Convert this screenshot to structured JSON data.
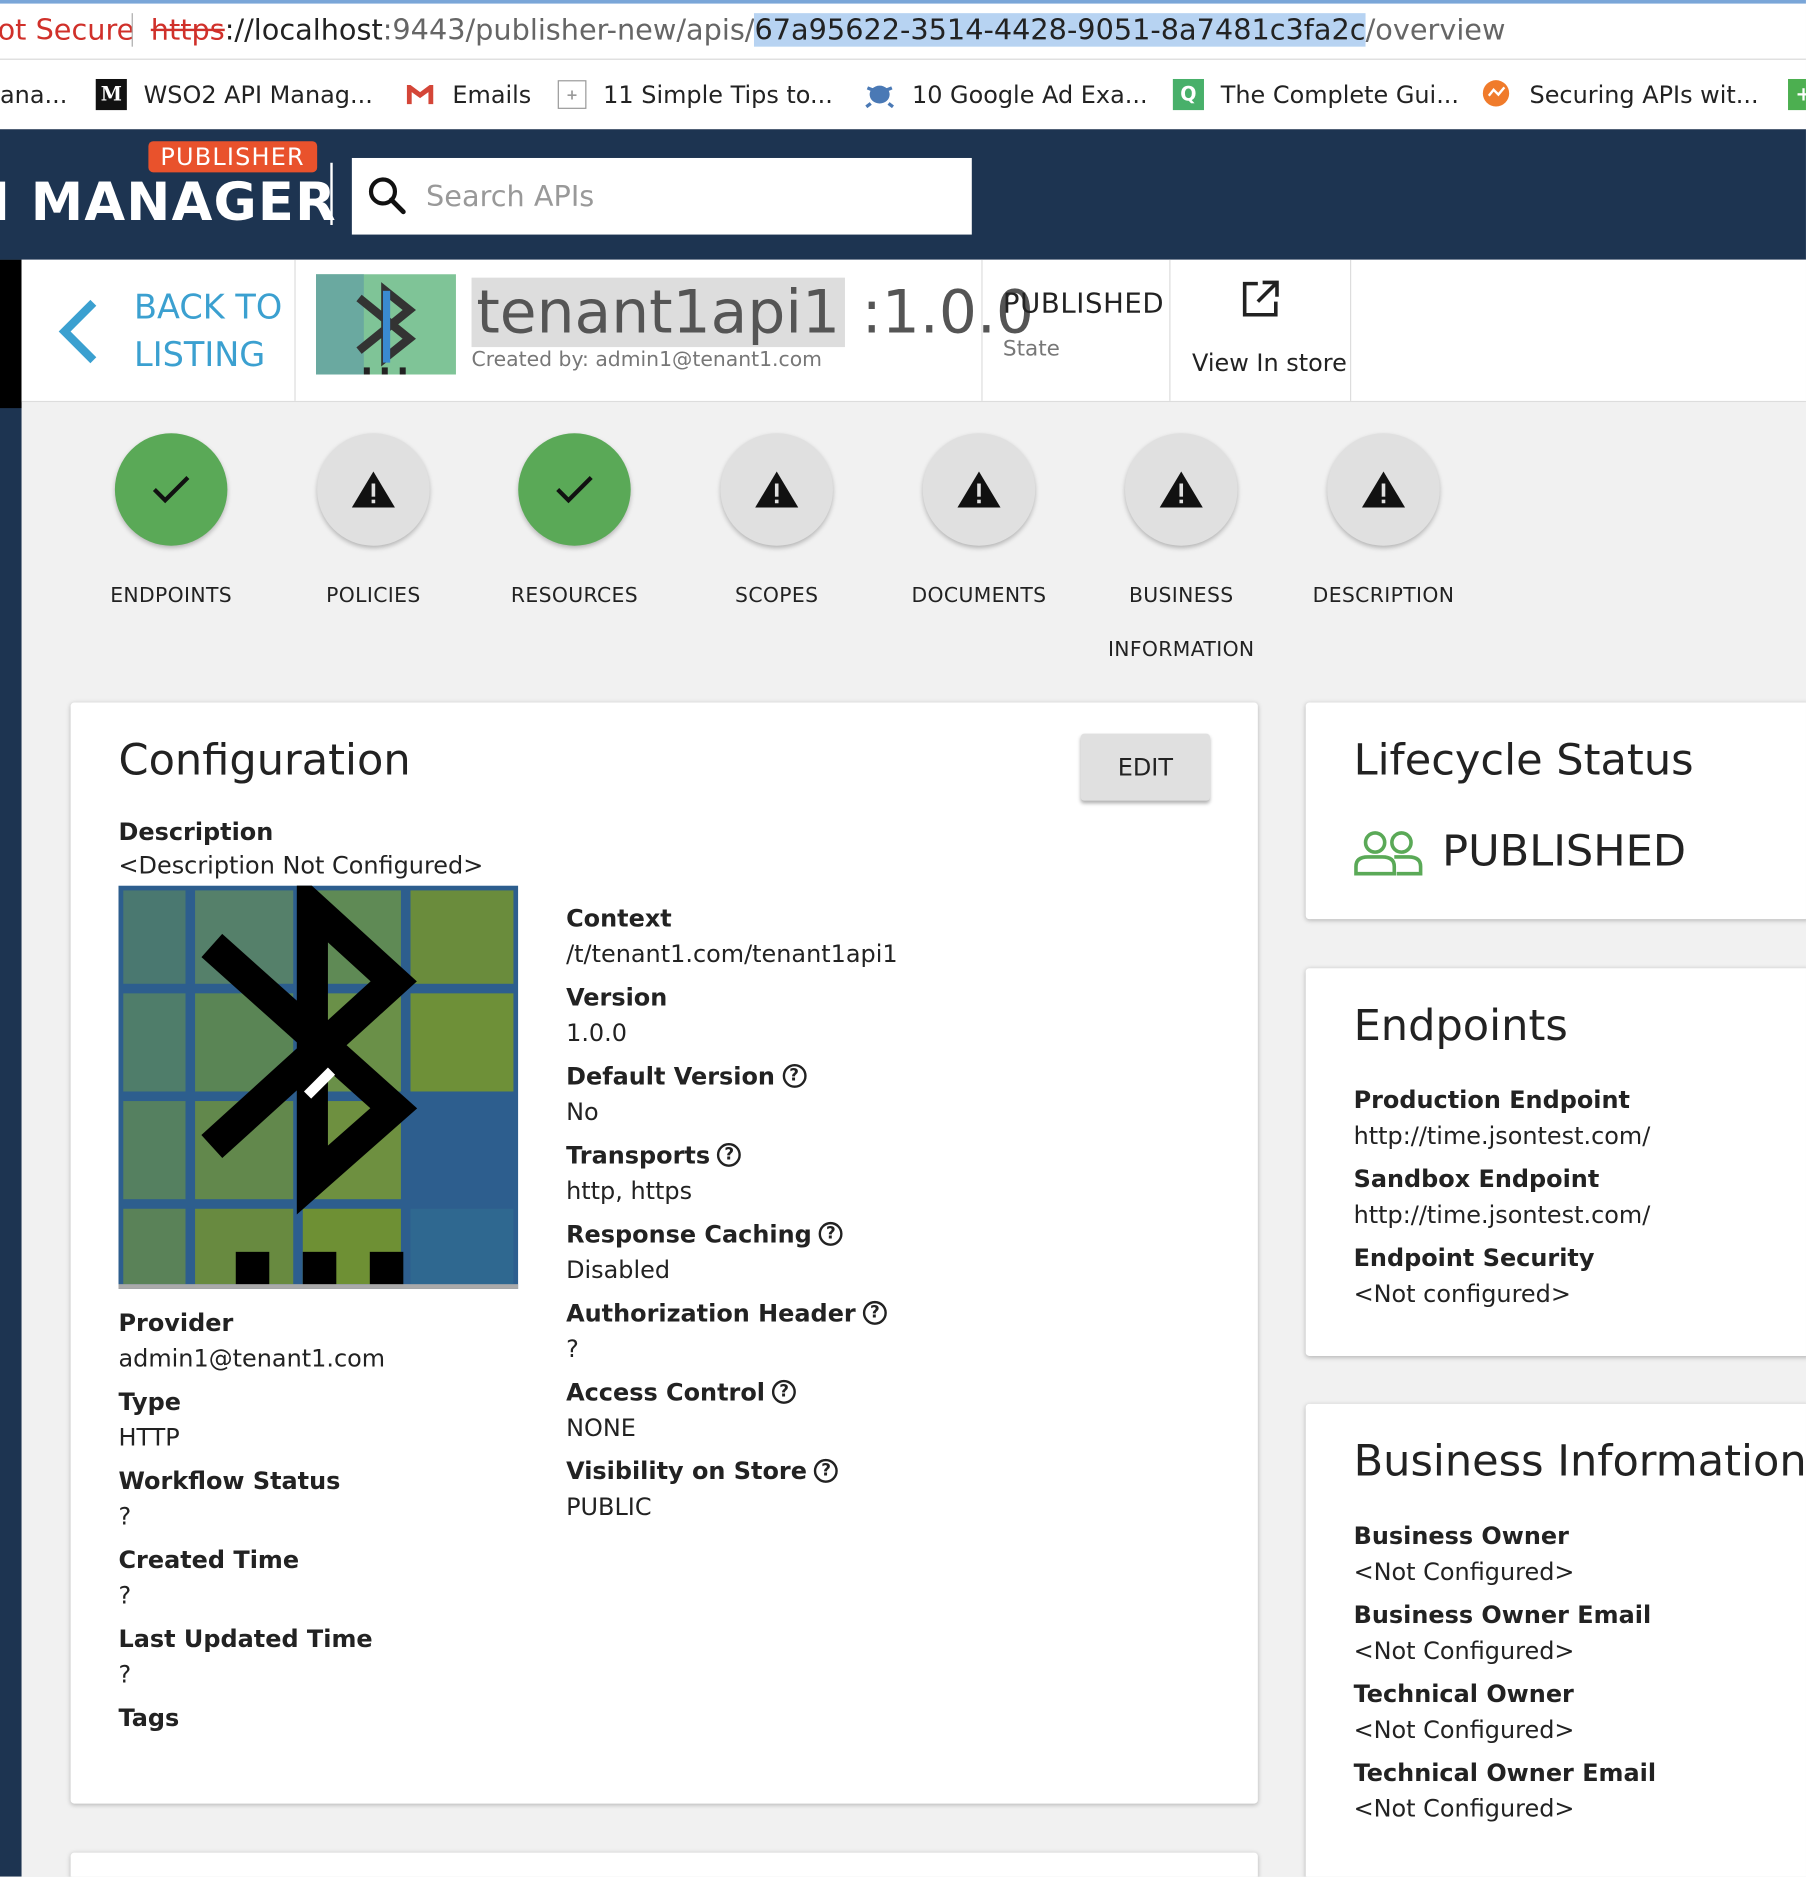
{
  "browser": {
    "security_label": "ot Secure",
    "url_scheme": "https",
    "url_host": "://localhost",
    "url_port_path": ":9443/publisher-new/apis/",
    "url_selected": "67a95622-3514-4428-9051-8a7481c3fa2c",
    "url_tail": "/overview"
  },
  "bookmarks": [
    {
      "label": "ana...",
      "icon": "none"
    },
    {
      "label": "WSO2 API Manag...",
      "icon": "medium-m-icon"
    },
    {
      "label": "Emails",
      "icon": "gmail-icon"
    },
    {
      "label": "11 Simple Tips to...",
      "icon": "bookmark-square-icon"
    },
    {
      "label": "10 Google Ad Exa...",
      "icon": "octocat-icon"
    },
    {
      "label": "The Complete Gui...",
      "icon": "q-icon"
    },
    {
      "label": "Securing APIs wit...",
      "icon": "postman-icon"
    }
  ],
  "header": {
    "badge": "PUBLISHER",
    "title": "I MANAGER",
    "search_placeholder": "Search APIs"
  },
  "api": {
    "back_label_1": "BACK TO",
    "back_label_2": "LISTING",
    "name": "tenant1api1",
    "version": ":1.0.0",
    "created_by": "Created by: admin1@tenant1.com",
    "state_value": "PUBLISHED",
    "state_label": "State",
    "view_store": "View In store"
  },
  "steps": [
    {
      "label": "ENDPOINTS",
      "status": "ok"
    },
    {
      "label": "POLICIES",
      "status": "warn"
    },
    {
      "label": "RESOURCES",
      "status": "ok"
    },
    {
      "label": "SCOPES",
      "status": "warn"
    },
    {
      "label": "DOCUMENTS",
      "status": "warn"
    },
    {
      "label": "BUSINESS INFORMATION",
      "status": "warn"
    },
    {
      "label": "DESCRIPTION",
      "status": "warn"
    }
  ],
  "config": {
    "title": "Configuration",
    "edit_label": "EDIT",
    "description_label": "Description",
    "description_value": "<Description Not Configured>",
    "left_fields": [
      {
        "label": "Provider",
        "value": "admin1@tenant1.com"
      },
      {
        "label": "Type",
        "value": "HTTP"
      },
      {
        "label": "Workflow Status",
        "value": "?"
      },
      {
        "label": "Created Time",
        "value": "?"
      },
      {
        "label": "Last Updated Time",
        "value": "?"
      },
      {
        "label": "Tags",
        "value": ""
      }
    ],
    "right_fields": [
      {
        "label": "Context",
        "value": "/t/tenant1.com/tenant1api1",
        "help": false
      },
      {
        "label": "Version",
        "value": "1.0.0",
        "help": false
      },
      {
        "label": "Default Version",
        "value": "No",
        "help": true
      },
      {
        "label": "Transports",
        "value": "http, https",
        "help": true
      },
      {
        "label": "Response Caching",
        "value": "Disabled",
        "help": true
      },
      {
        "label": "Authorization Header",
        "value": "?",
        "help": true
      },
      {
        "label": "Access Control",
        "value": "NONE",
        "help": true
      },
      {
        "label": "Visibility on Store",
        "value": "PUBLIC",
        "help": true
      }
    ]
  },
  "lifecycle": {
    "title": "Lifecycle Status",
    "status": "PUBLISHED"
  },
  "endpoints": {
    "title": "Endpoints",
    "fields": [
      {
        "label": "Production Endpoint",
        "value": "http://time.jsontest.com/"
      },
      {
        "label": "Sandbox Endpoint",
        "value": "http://time.jsontest.com/"
      },
      {
        "label": "Endpoint Security",
        "value": "<Not configured>"
      }
    ]
  },
  "business": {
    "title": "Business Information",
    "fields": [
      {
        "label": "Business Owner",
        "value": "<Not Configured>"
      },
      {
        "label": "Business Owner Email",
        "value": "<Not Configured>"
      },
      {
        "label": "Technical Owner",
        "value": "<Not Configured>"
      },
      {
        "label": "Technical Owner Email",
        "value": "<Not Configured>"
      }
    ]
  },
  "colors": {
    "header_bg": "#1d3451",
    "publisher_badge": "#e9522c",
    "success_green": "#5aa957",
    "link_blue": "#3ba0d0"
  }
}
